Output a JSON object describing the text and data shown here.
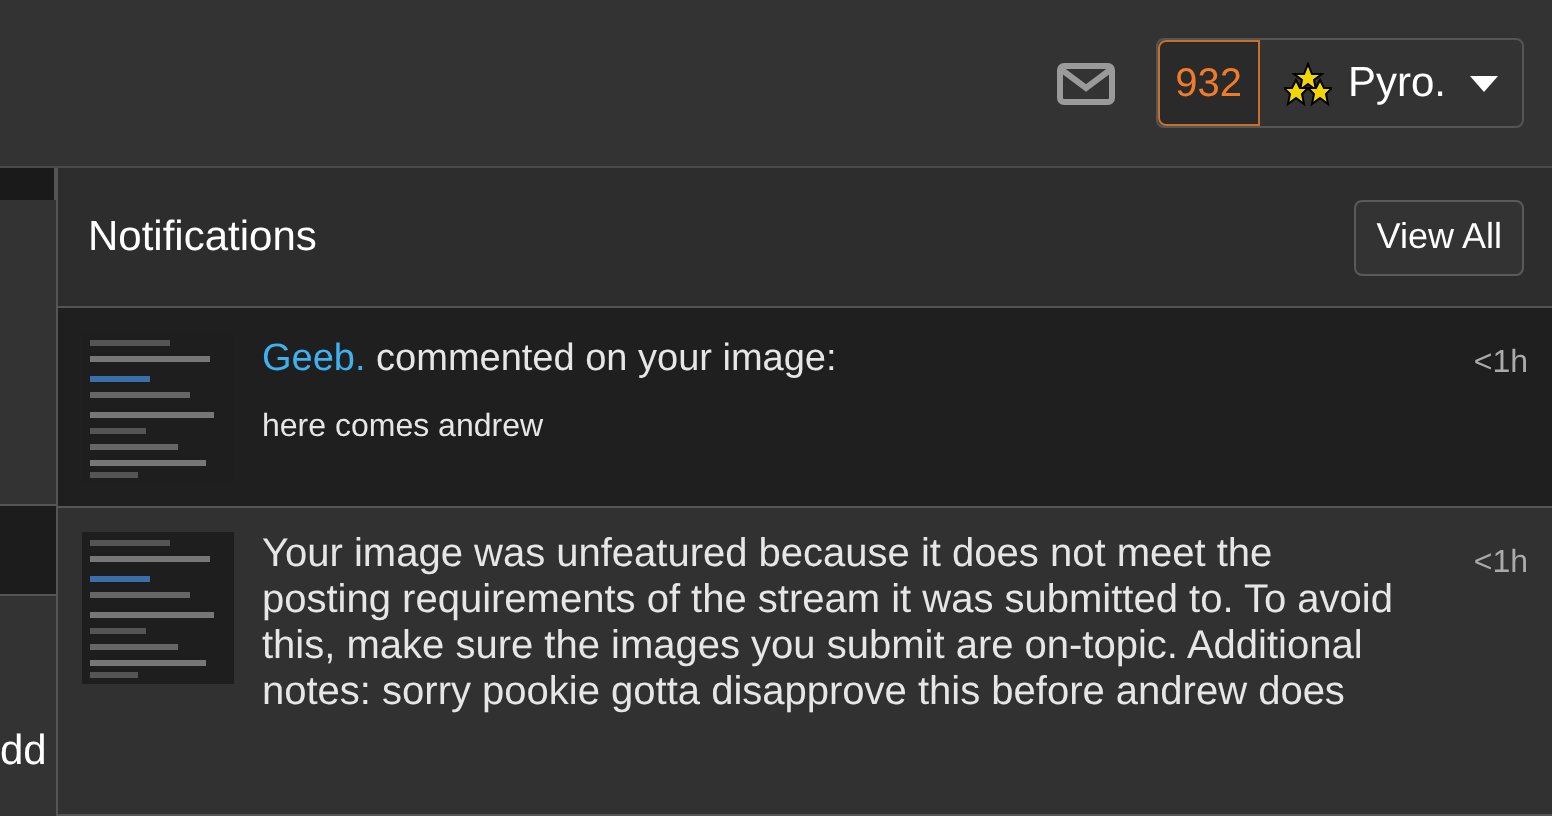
{
  "header": {
    "points": "932",
    "username": "Pyro."
  },
  "left_fragment": {
    "text": "dd"
  },
  "notifications_panel": {
    "title": "Notifications",
    "view_all": "View All",
    "items": [
      {
        "kind": "comment",
        "unread": true,
        "actor": "Geeb.",
        "action": "commented on your image:",
        "body": "here comes andrew",
        "time": "<1h"
      },
      {
        "kind": "notice",
        "unread": false,
        "body": "Your image was unfeatured because it does not meet the posting requirements of the stream it was submitted to. To avoid this, make sure the images you submit are on-topic. Additional notes: sorry pookie gotta disapprove this before andrew does",
        "time": "<1h"
      }
    ]
  }
}
